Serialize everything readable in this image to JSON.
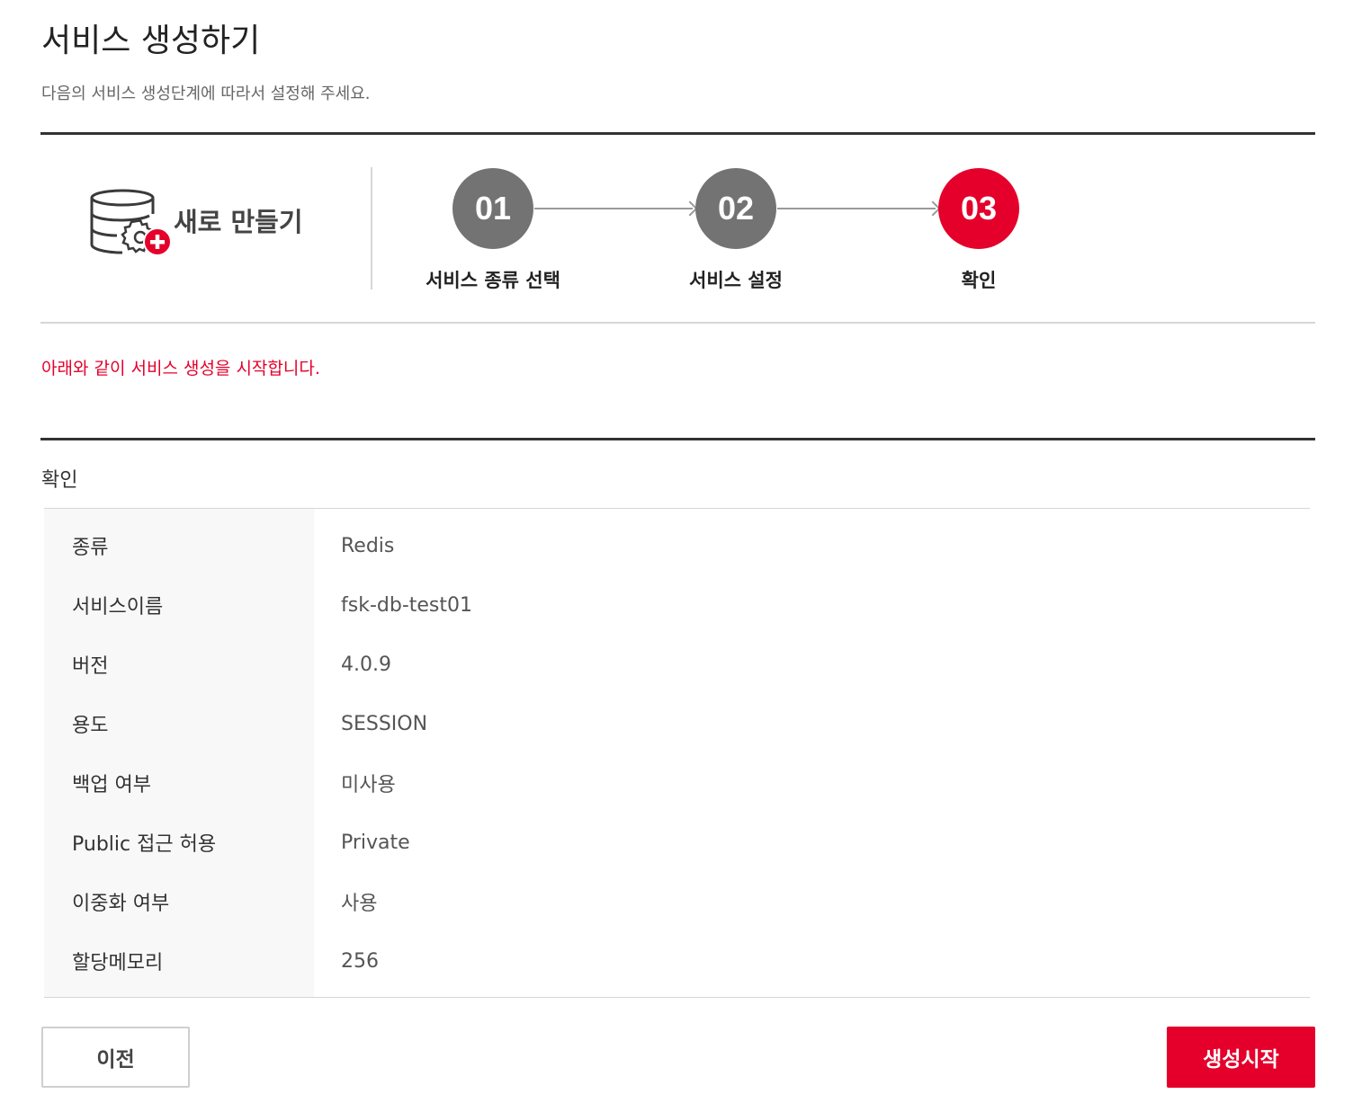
{
  "page": {
    "title": "서비스 생성하기",
    "subtitle": "다음의 서비스 생성단계에 따라서 설정해 주세요."
  },
  "wizard": {
    "brand_label": "새로 만들기",
    "steps": [
      {
        "number": "01",
        "label": "서비스 종류 선택",
        "active": false
      },
      {
        "number": "02",
        "label": "서비스 설정",
        "active": false
      },
      {
        "number": "03",
        "label": "확인",
        "active": true
      }
    ]
  },
  "notice": "아래와 같이 서비스 생성을 시작합니다.",
  "confirm": {
    "section_title": "확인",
    "rows": [
      {
        "key": "종류",
        "value": "Redis"
      },
      {
        "key": "서비스이름",
        "value": "fsk-db-test01"
      },
      {
        "key": "버전",
        "value": "4.0.9"
      },
      {
        "key": "용도",
        "value": "SESSION"
      },
      {
        "key": "백업 여부",
        "value": "미사용"
      },
      {
        "key": "Public 접근 허용",
        "value": "Private"
      },
      {
        "key": "이중화 여부",
        "value": "사용"
      },
      {
        "key": "할당메모리",
        "value": "256"
      }
    ]
  },
  "buttons": {
    "prev_label": "이전",
    "start_label": "생성시작"
  },
  "colors": {
    "accent": "#e4002b",
    "step_inactive": "#737373"
  }
}
